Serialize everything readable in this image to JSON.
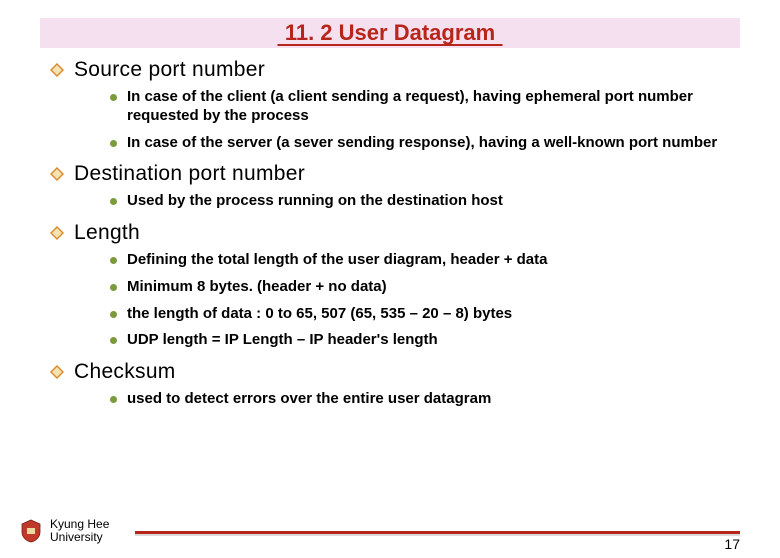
{
  "title": "11. 2 User Datagram",
  "sections": [
    {
      "heading": "Source port number",
      "items": [
        "In case of the client (a client sending a request), having ephemeral port number requested by the process",
        "In case of the server (a sever sending response), having a well-known port number"
      ]
    },
    {
      "heading": "Destination port number",
      "items": [
        "Used by the process running on the destination host"
      ]
    },
    {
      "heading": "Length",
      "items": [
        "Defining the total length of the user diagram, header + data",
        "Minimum 8 bytes. (header + no data)",
        "the length of data : 0 to 65, 507 (65, 535 – 20 – 8) bytes",
        "UDP length = IP Length – IP header's length"
      ]
    },
    {
      "heading": "Checksum",
      "items": [
        "used to detect errors over the entire user datagram"
      ]
    }
  ],
  "footer": {
    "university_line1": "Kyung Hee",
    "university_line2": "University",
    "page_number": "17"
  }
}
